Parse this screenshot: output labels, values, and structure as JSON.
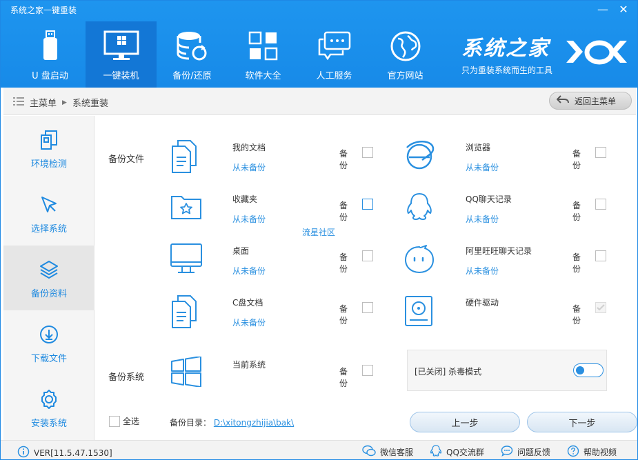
{
  "window": {
    "title": "系统之家一键重装",
    "minimize": "—",
    "close": "✕"
  },
  "nav": [
    {
      "label": "U 盘启动",
      "icon": "usb-drive-icon"
    },
    {
      "label": "一键装机",
      "icon": "monitor-windows-icon",
      "active": true
    },
    {
      "label": "备份/还原",
      "icon": "database-restore-icon"
    },
    {
      "label": "软件大全",
      "icon": "apps-grid-icon"
    },
    {
      "label": "人工服务",
      "icon": "chat-icon"
    },
    {
      "label": "官方网站",
      "icon": "globe-icon"
    }
  ],
  "brand": {
    "name": "系统之家",
    "slogan": "只为重装系统而生的工具"
  },
  "breadcrumb": {
    "root": "主菜单",
    "current": "系统重装"
  },
  "back_button": "返回主菜单",
  "sidebar": [
    {
      "label": "环境检测",
      "icon": "environment-check-icon"
    },
    {
      "label": "选择系统",
      "icon": "cursor-icon"
    },
    {
      "label": "备份资料",
      "icon": "layers-icon",
      "active": true
    },
    {
      "label": "下载文件",
      "icon": "download-icon"
    },
    {
      "label": "安装系统",
      "icon": "gear-icon"
    }
  ],
  "sections": {
    "files": "备份文件",
    "system": "备份系统"
  },
  "backup_items": {
    "my_docs": {
      "title": "我的文档",
      "status": "从未备份",
      "action": "备份"
    },
    "browser": {
      "title": "浏览器",
      "status": "从未备份",
      "action": "备份"
    },
    "favorites": {
      "title": "收藏夹",
      "status": "从未备份",
      "action": "备份"
    },
    "qq": {
      "title": "QQ聊天记录",
      "status": "从未备份",
      "action": "备份"
    },
    "desktop": {
      "title": "桌面",
      "status": "从未备份",
      "action": "备份"
    },
    "aliww": {
      "title": "阿里旺旺聊天记录",
      "status": "从未备份",
      "action": "备份"
    },
    "c_docs": {
      "title": "C盘文档",
      "status": "从未备份",
      "action": "备份"
    },
    "drivers": {
      "title": "硬件驱动",
      "action": "备份"
    },
    "current_system": {
      "title": "当前系统",
      "action": "备份"
    }
  },
  "watermark": "流星社区",
  "antivirus": {
    "text": "[已关闭] 杀毒模式"
  },
  "select_all": "全选",
  "backup_dir": {
    "label": "备份目录：",
    "path": "D:\\xitongzhijia\\bak\\"
  },
  "buttons": {
    "prev": "上一步",
    "next": "下一步"
  },
  "footer": {
    "version": "VER[11.5.47.1530]",
    "links": [
      {
        "label": "微信客服",
        "icon": "wechat-icon"
      },
      {
        "label": "QQ交流群",
        "icon": "qq-icon"
      },
      {
        "label": "问题反馈",
        "icon": "feedback-icon"
      },
      {
        "label": "帮助视频",
        "icon": "help-icon"
      }
    ]
  },
  "colors": {
    "header": "#1e95ef",
    "active_nav": "#1377d6",
    "accent": "#2a90e0"
  }
}
